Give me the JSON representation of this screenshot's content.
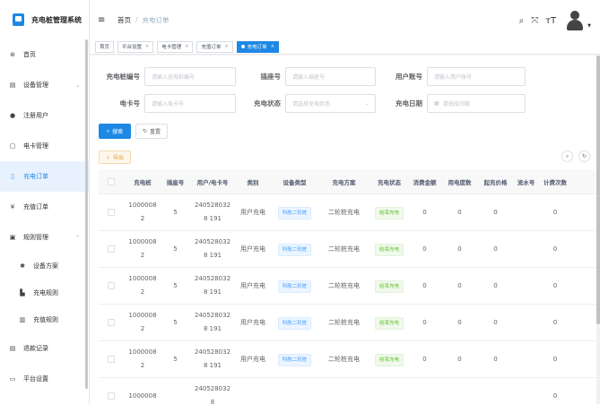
{
  "app": {
    "title": "充电桩管理系统"
  },
  "sidebar": {
    "items": [
      {
        "label": "首页",
        "icon": "dashboard-icon",
        "glyph": "⊛"
      },
      {
        "label": "设备管理",
        "icon": "monitor-icon",
        "glyph": "▤",
        "chevron": "⌄"
      },
      {
        "label": "注册用户",
        "icon": "user-icon",
        "glyph": "●"
      },
      {
        "label": "电卡管理",
        "icon": "card-icon",
        "glyph": "▢"
      },
      {
        "label": "充电订单",
        "icon": "order-icon",
        "glyph": "▯"
      },
      {
        "label": "充值订单",
        "icon": "yen-icon",
        "glyph": "¥"
      },
      {
        "label": "规则管理",
        "icon": "rules-icon",
        "glyph": "▣",
        "chevron": "⌃"
      },
      {
        "label": "设备方案",
        "icon": "gear-icon",
        "glyph": "✱"
      },
      {
        "label": "充电规则",
        "icon": "doc-icon",
        "glyph": "▙"
      },
      {
        "label": "充值规则",
        "icon": "file-icon",
        "glyph": "▥"
      },
      {
        "label": "退款记录",
        "icon": "refund-icon",
        "glyph": "▤"
      },
      {
        "label": "平台设置",
        "icon": "settings-icon",
        "glyph": "▭"
      }
    ]
  },
  "header": {
    "breadcrumb": [
      "首页",
      "充电订单"
    ],
    "separator": "/",
    "icons": {
      "search": "⌕",
      "fullscreen": "⤧",
      "size": "тT",
      "caret": "▼",
      "menu": "≡"
    }
  },
  "tags": [
    {
      "label": "首页",
      "closable": false
    },
    {
      "label": "平台设置",
      "closable": true
    },
    {
      "label": "电卡管理",
      "closable": true
    },
    {
      "label": "充值订单",
      "closable": true
    },
    {
      "label": "充电订单",
      "closable": true,
      "active": true
    }
  ],
  "tag_close": "×",
  "filters": {
    "pile_no": {
      "label": "充电桩编号",
      "placeholder": "请输入充电桩编号"
    },
    "socket_no": {
      "label": "插座号",
      "placeholder": "请输入插座号"
    },
    "user_account": {
      "label": "用户账号",
      "placeholder": "请输入用户账号"
    },
    "card_no": {
      "label": "电卡号",
      "placeholder": "请输入电卡号"
    },
    "charge_status": {
      "label": "充电状态",
      "placeholder": "请选择充电状态",
      "arrow": "⌄"
    },
    "charge_date": {
      "label": "充电日期",
      "placeholder": "请选择日期",
      "icon": "▦"
    }
  },
  "buttons": {
    "search": "搜索",
    "search_icon": "⌕",
    "reset": "重置",
    "reset_icon": "↻",
    "export": "导出",
    "export_icon": "⇣",
    "toggle_search": "⌕",
    "refresh": "↻"
  },
  "table": {
    "columns": [
      "",
      "充电桩",
      "插座号",
      "用户/电卡号",
      "类别",
      "设备类型",
      "充电方案",
      "充电状态",
      "消费金额",
      "用电度数",
      "起充价格",
      "流水号",
      "计费次数"
    ],
    "rows": [
      {
        "pile": "1000008 2",
        "socket": "5",
        "user": "2405280328 191",
        "category": "用户充电",
        "device": "科航二轮桩",
        "plan": "二轮桩充电",
        "status": "结束充电",
        "amount": "0",
        "kwh": "0",
        "start_price": "0",
        "serial": "",
        "count": "0"
      },
      {
        "pile": "1000008 2",
        "socket": "5",
        "user": "2405280328 191",
        "category": "用户充电",
        "device": "科航二轮桩",
        "plan": "二轮桩充电",
        "status": "结束充电",
        "amount": "0",
        "kwh": "0",
        "start_price": "0",
        "serial": "",
        "count": "0"
      },
      {
        "pile": "1000008 2",
        "socket": "5",
        "user": "2405280328 191",
        "category": "用户充电",
        "device": "科航二轮桩",
        "plan": "二轮桩充电",
        "status": "结束充电",
        "amount": "0",
        "kwh": "0",
        "start_price": "0",
        "serial": "",
        "count": "0"
      },
      {
        "pile": "1000008 2",
        "socket": "5",
        "user": "2405280328 191",
        "category": "用户充电",
        "device": "科航二轮桩",
        "plan": "二轮桩充电",
        "status": "结束充电",
        "amount": "0",
        "kwh": "0",
        "start_price": "0",
        "serial": "",
        "count": "0"
      },
      {
        "pile": "1000008 2",
        "socket": "5",
        "user": "2405280328 191",
        "category": "用户充电",
        "device": "科航二轮桩",
        "plan": "二轮桩充电",
        "status": "结束充电",
        "amount": "0",
        "kwh": "0",
        "start_price": "0",
        "serial": "",
        "count": "0"
      },
      {
        "pile": "1000008",
        "socket": "",
        "user": "2405280328",
        "category": "",
        "device": "",
        "plan": "",
        "status": "",
        "amount": "",
        "kwh": "",
        "start_price": "",
        "serial": "",
        "count": "0"
      }
    ]
  },
  "colors": {
    "primary": "#1e88e5",
    "success": "#67c23a",
    "warning": "#e6a23c"
  }
}
